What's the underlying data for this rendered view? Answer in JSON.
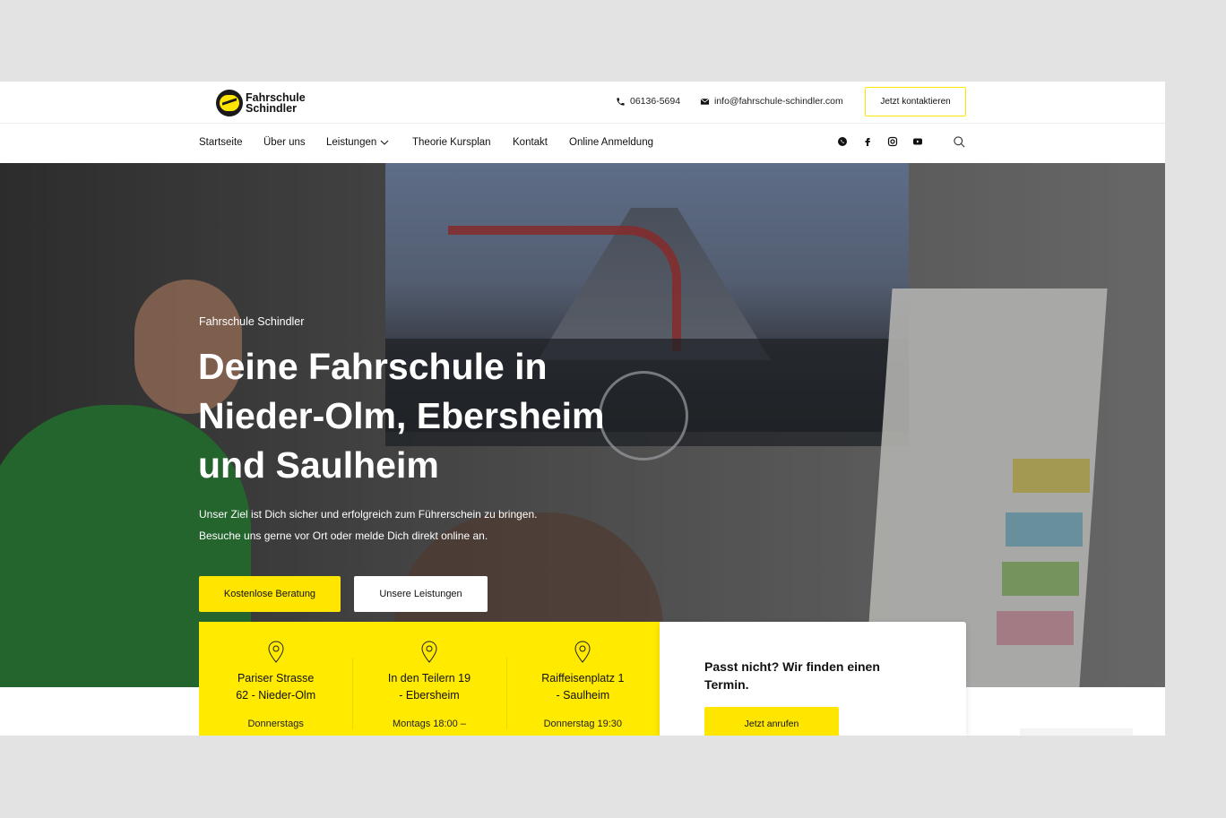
{
  "brand": {
    "line1": "Fahrschule",
    "line2": "Schindler"
  },
  "topbar": {
    "phone": "06136-5694",
    "email": "info@fahrschule-schindler.com",
    "cta": "Jetzt kontaktieren"
  },
  "nav": {
    "items": [
      "Startseite",
      "Über uns",
      "Leistungen",
      "Theorie Kursplan",
      "Kontakt",
      "Online Anmeldung"
    ],
    "social_icons": [
      "whatsapp-icon",
      "facebook-icon",
      "instagram-icon",
      "youtube-icon"
    ]
  },
  "hero": {
    "eyebrow": "Fahrschule Schindler",
    "headline": "Deine Fahrschule in Nieder-Olm, Ebersheim und Saulheim",
    "subline_1": "Unser Ziel ist Dich sicher und erfolgreich zum Führerschein zu bringen.",
    "subline_2": "Besuche uns gerne vor Ort oder melde Dich direkt online an.",
    "button_primary": "Kostenlose Beratung",
    "button_secondary": "Unsere Leistungen"
  },
  "locations": [
    {
      "line1": "Pariser Strasse",
      "line2": "62 - Nieder-Olm",
      "hours": "Donnerstags"
    },
    {
      "line1": "In den Teilern 19",
      "line2": "- Ebersheim",
      "hours": "Montags 18:00 –"
    },
    {
      "line1": "Raiffeisenplatz 1",
      "line2": "- Saulheim",
      "hours": "Donnerstag 19:30"
    }
  ],
  "termin": {
    "title": "Passt nicht? Wir finden einen Termin.",
    "button": "Jetzt anrufen"
  },
  "colors": {
    "accent": "#ffe600",
    "text": "#111111"
  }
}
